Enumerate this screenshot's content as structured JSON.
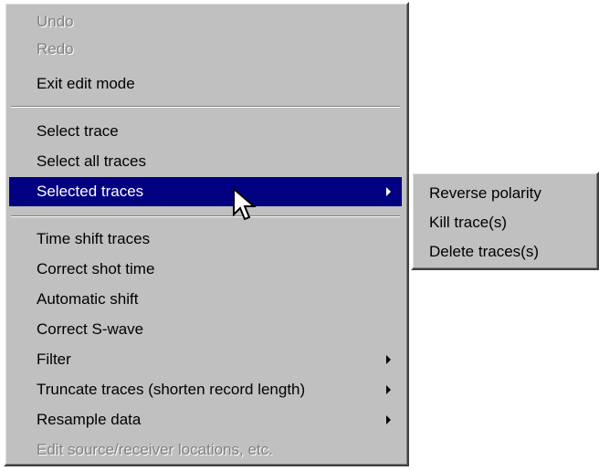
{
  "context_menu": {
    "items": [
      {
        "label": "Undo",
        "enabled": false
      },
      {
        "label": "Redo",
        "enabled": false
      },
      {
        "label": "Exit edit mode",
        "enabled": true
      },
      {
        "label": "Select trace",
        "enabled": true
      },
      {
        "label": "Select all traces",
        "enabled": true
      },
      {
        "label": "Selected traces",
        "enabled": true,
        "has_submenu": true,
        "highlighted": true
      },
      {
        "label": "Time shift traces",
        "enabled": true
      },
      {
        "label": "Correct shot time",
        "enabled": true
      },
      {
        "label": "Automatic shift",
        "enabled": true
      },
      {
        "label": "Correct S-wave",
        "enabled": true
      },
      {
        "label": "Filter",
        "enabled": true,
        "has_submenu": true
      },
      {
        "label": "Truncate traces (shorten record length)",
        "enabled": true,
        "has_submenu": true
      },
      {
        "label": "Resample data",
        "enabled": true,
        "has_submenu": true
      },
      {
        "label": "Edit source/receiver locations, etc.",
        "enabled": false
      }
    ]
  },
  "submenu": {
    "items": [
      {
        "label": "Reverse polarity"
      },
      {
        "label": "Kill trace(s)"
      },
      {
        "label": "Delete traces(s)"
      }
    ]
  },
  "colors": {
    "menu_face": "#c0c0c0",
    "highlight": "#000080",
    "disabled_text": "#808080"
  },
  "icons": {
    "submenu_arrow": "triangle-right",
    "pointer": "arrow-cursor"
  }
}
